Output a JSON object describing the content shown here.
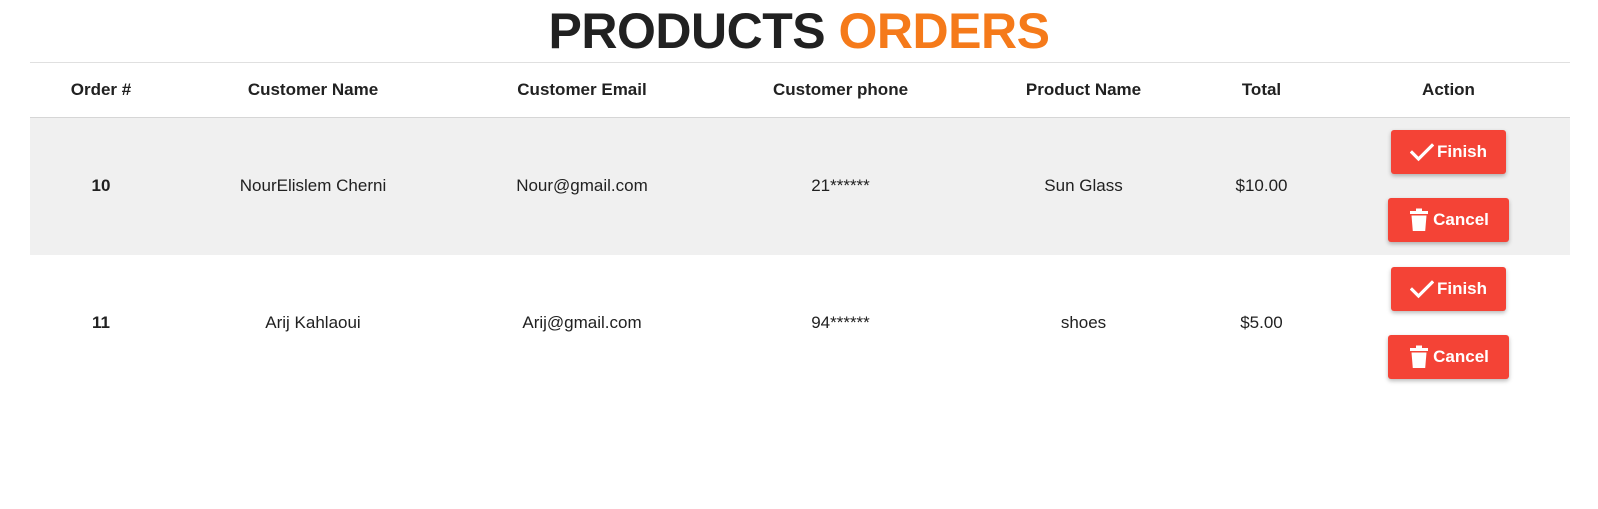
{
  "header": {
    "title_part1": "PRODUCTS",
    "title_part2": "ORDERS",
    "accent_color": "#f57a1a"
  },
  "table": {
    "columns": [
      "Order #",
      "Customer Name",
      "Customer Email",
      "Customer phone",
      "Product Name",
      "Total",
      "Action"
    ],
    "rows": [
      {
        "order": "10",
        "name": "NourElislem Cherni",
        "email": "Nour@gmail.com",
        "phone": "21******",
        "product": "Sun Glass",
        "total": "$10.00",
        "finish_label": "Finish",
        "cancel_label": "Cancel"
      },
      {
        "order": "11",
        "name": "Arij Kahlaoui",
        "email": "Arij@gmail.com",
        "phone": "94******",
        "product": "shoes",
        "total": "$5.00",
        "finish_label": "Finish",
        "cancel_label": "Cancel"
      }
    ]
  },
  "icons": {
    "finish": "check-icon",
    "cancel": "trash-icon"
  },
  "colors": {
    "button_red": "#f44336",
    "row_shade": "#f0f0f0"
  }
}
